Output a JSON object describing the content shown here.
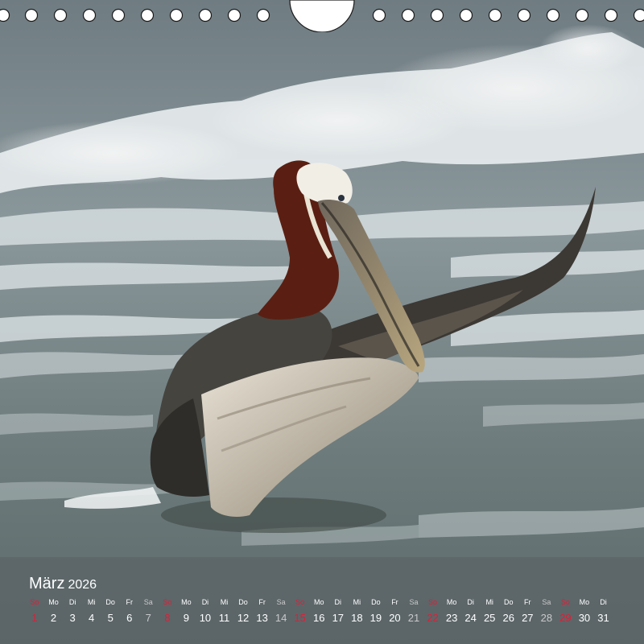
{
  "calendar": {
    "month": "März",
    "year": "2026",
    "days": [
      {
        "wd": "So",
        "d": "1",
        "t": "sun"
      },
      {
        "wd": "Mo",
        "d": "2",
        "t": "wk"
      },
      {
        "wd": "Di",
        "d": "3",
        "t": "wk"
      },
      {
        "wd": "Mi",
        "d": "4",
        "t": "wk"
      },
      {
        "wd": "Do",
        "d": "5",
        "t": "wk"
      },
      {
        "wd": "Fr",
        "d": "6",
        "t": "wk"
      },
      {
        "wd": "Sa",
        "d": "7",
        "t": "sat"
      },
      {
        "wd": "So",
        "d": "8",
        "t": "sun"
      },
      {
        "wd": "Mo",
        "d": "9",
        "t": "wk"
      },
      {
        "wd": "Di",
        "d": "10",
        "t": "wk"
      },
      {
        "wd": "Mi",
        "d": "11",
        "t": "wk"
      },
      {
        "wd": "Do",
        "d": "12",
        "t": "wk"
      },
      {
        "wd": "Fr",
        "d": "13",
        "t": "wk"
      },
      {
        "wd": "Sa",
        "d": "14",
        "t": "sat"
      },
      {
        "wd": "So",
        "d": "15",
        "t": "sun"
      },
      {
        "wd": "Mo",
        "d": "16",
        "t": "wk"
      },
      {
        "wd": "Di",
        "d": "17",
        "t": "wk"
      },
      {
        "wd": "Mi",
        "d": "18",
        "t": "wk"
      },
      {
        "wd": "Do",
        "d": "19",
        "t": "wk"
      },
      {
        "wd": "Fr",
        "d": "20",
        "t": "wk"
      },
      {
        "wd": "Sa",
        "d": "21",
        "t": "sat"
      },
      {
        "wd": "So",
        "d": "22",
        "t": "sun"
      },
      {
        "wd": "Mo",
        "d": "23",
        "t": "wk"
      },
      {
        "wd": "Di",
        "d": "24",
        "t": "wk"
      },
      {
        "wd": "Mi",
        "d": "25",
        "t": "wk"
      },
      {
        "wd": "Do",
        "d": "26",
        "t": "wk"
      },
      {
        "wd": "Fr",
        "d": "27",
        "t": "wk"
      },
      {
        "wd": "Sa",
        "d": "28",
        "t": "sat"
      },
      {
        "wd": "So",
        "d": "29",
        "t": "sun"
      },
      {
        "wd": "Mo",
        "d": "30",
        "t": "wk"
      },
      {
        "wd": "Di",
        "d": "31",
        "t": "wk"
      }
    ]
  },
  "colors": {
    "sunday": "#e21d36",
    "saturday": "#c9c9c9",
    "weekday": "#ffffff"
  },
  "icons": [
    "binding-ring-icon",
    "hanger-notch-icon"
  ]
}
